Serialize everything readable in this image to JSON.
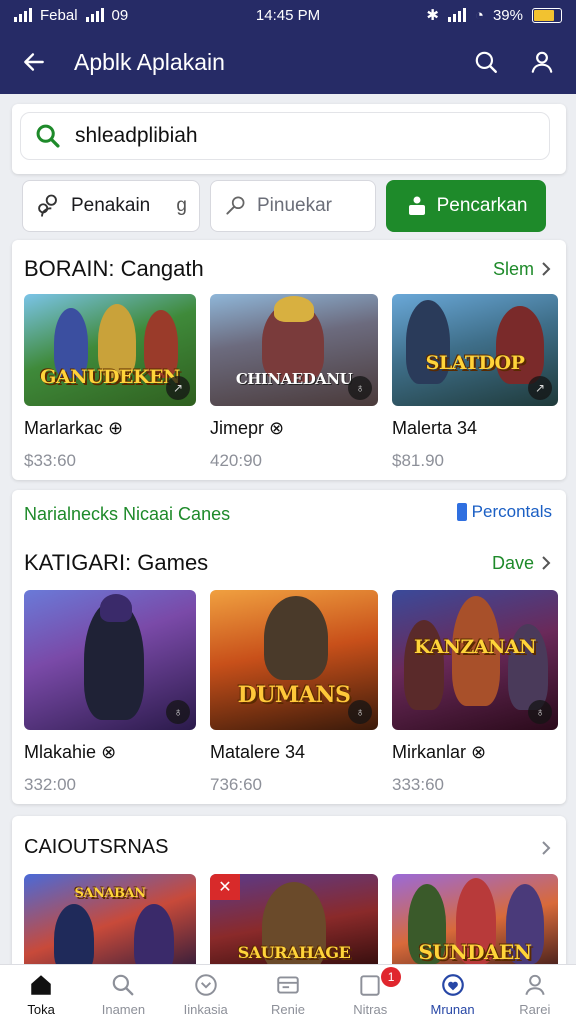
{
  "status_bar": {
    "carrier": "Febal",
    "left_extra": "09",
    "time": "14:45 PM",
    "battery": "39%"
  },
  "app_bar": {
    "title": "Apblk Aplakain"
  },
  "search": {
    "value": "shleadplibiah"
  },
  "filters": [
    {
      "label": "Penakain",
      "extra": "g"
    },
    {
      "label": "Pinuekar"
    },
    {
      "label": "Pencarkan"
    }
  ],
  "section1": {
    "heading": "BORAIN: Cangath",
    "more": "Slem",
    "items": [
      {
        "name": "Marlarkac",
        "name_mark": "⊕",
        "price": "$33:60",
        "logo": "GANUDEKEN"
      },
      {
        "name": "Jimepr",
        "name_mark": "⊗",
        "price": "420:90",
        "logo": "CHINAEDANU"
      },
      {
        "name": "Malerta 34",
        "name_mark": "",
        "price": "$81.90",
        "logo": "SLATDOP"
      }
    ]
  },
  "section2": {
    "tagline": "Narialnecks Nicaai Canes",
    "tagright": "Percontals",
    "heading": "KATIGARI: Games",
    "more": "Dave",
    "items": [
      {
        "name": "Mlakahie",
        "name_mark": "⊗",
        "price": "332:00",
        "logo": ""
      },
      {
        "name": "Matalere 34",
        "name_mark": "",
        "price": "736:60",
        "logo": "DUMANS"
      },
      {
        "name": "Mirkanlar",
        "name_mark": "⊗",
        "price": "333:60",
        "logo": "KANZANAN"
      }
    ]
  },
  "section3": {
    "heading": "CAIOUTSRNAS",
    "items": [
      {
        "logo": "SANABAN"
      },
      {
        "logo": "SAURAHAGE"
      },
      {
        "logo": "SUNDAEN"
      }
    ]
  },
  "bottom_nav": [
    {
      "label": "Toka",
      "icon": "home-icon"
    },
    {
      "label": "Inamen",
      "icon": "search-icon"
    },
    {
      "label": "Iinkasia",
      "icon": "heart-icon"
    },
    {
      "label": "Renie",
      "icon": "wallet-icon"
    },
    {
      "label": "Nitras",
      "icon": "notifications-icon",
      "badge": "1"
    },
    {
      "label": "Mrunan",
      "icon": "favorites-icon"
    },
    {
      "label": "Rarei",
      "icon": "profile-icon"
    }
  ],
  "colors": {
    "app_bar": "#262b66",
    "accent_green": "#1e8a2a",
    "link_blue": "#1b5fc4",
    "badge_red": "#e0262d"
  }
}
